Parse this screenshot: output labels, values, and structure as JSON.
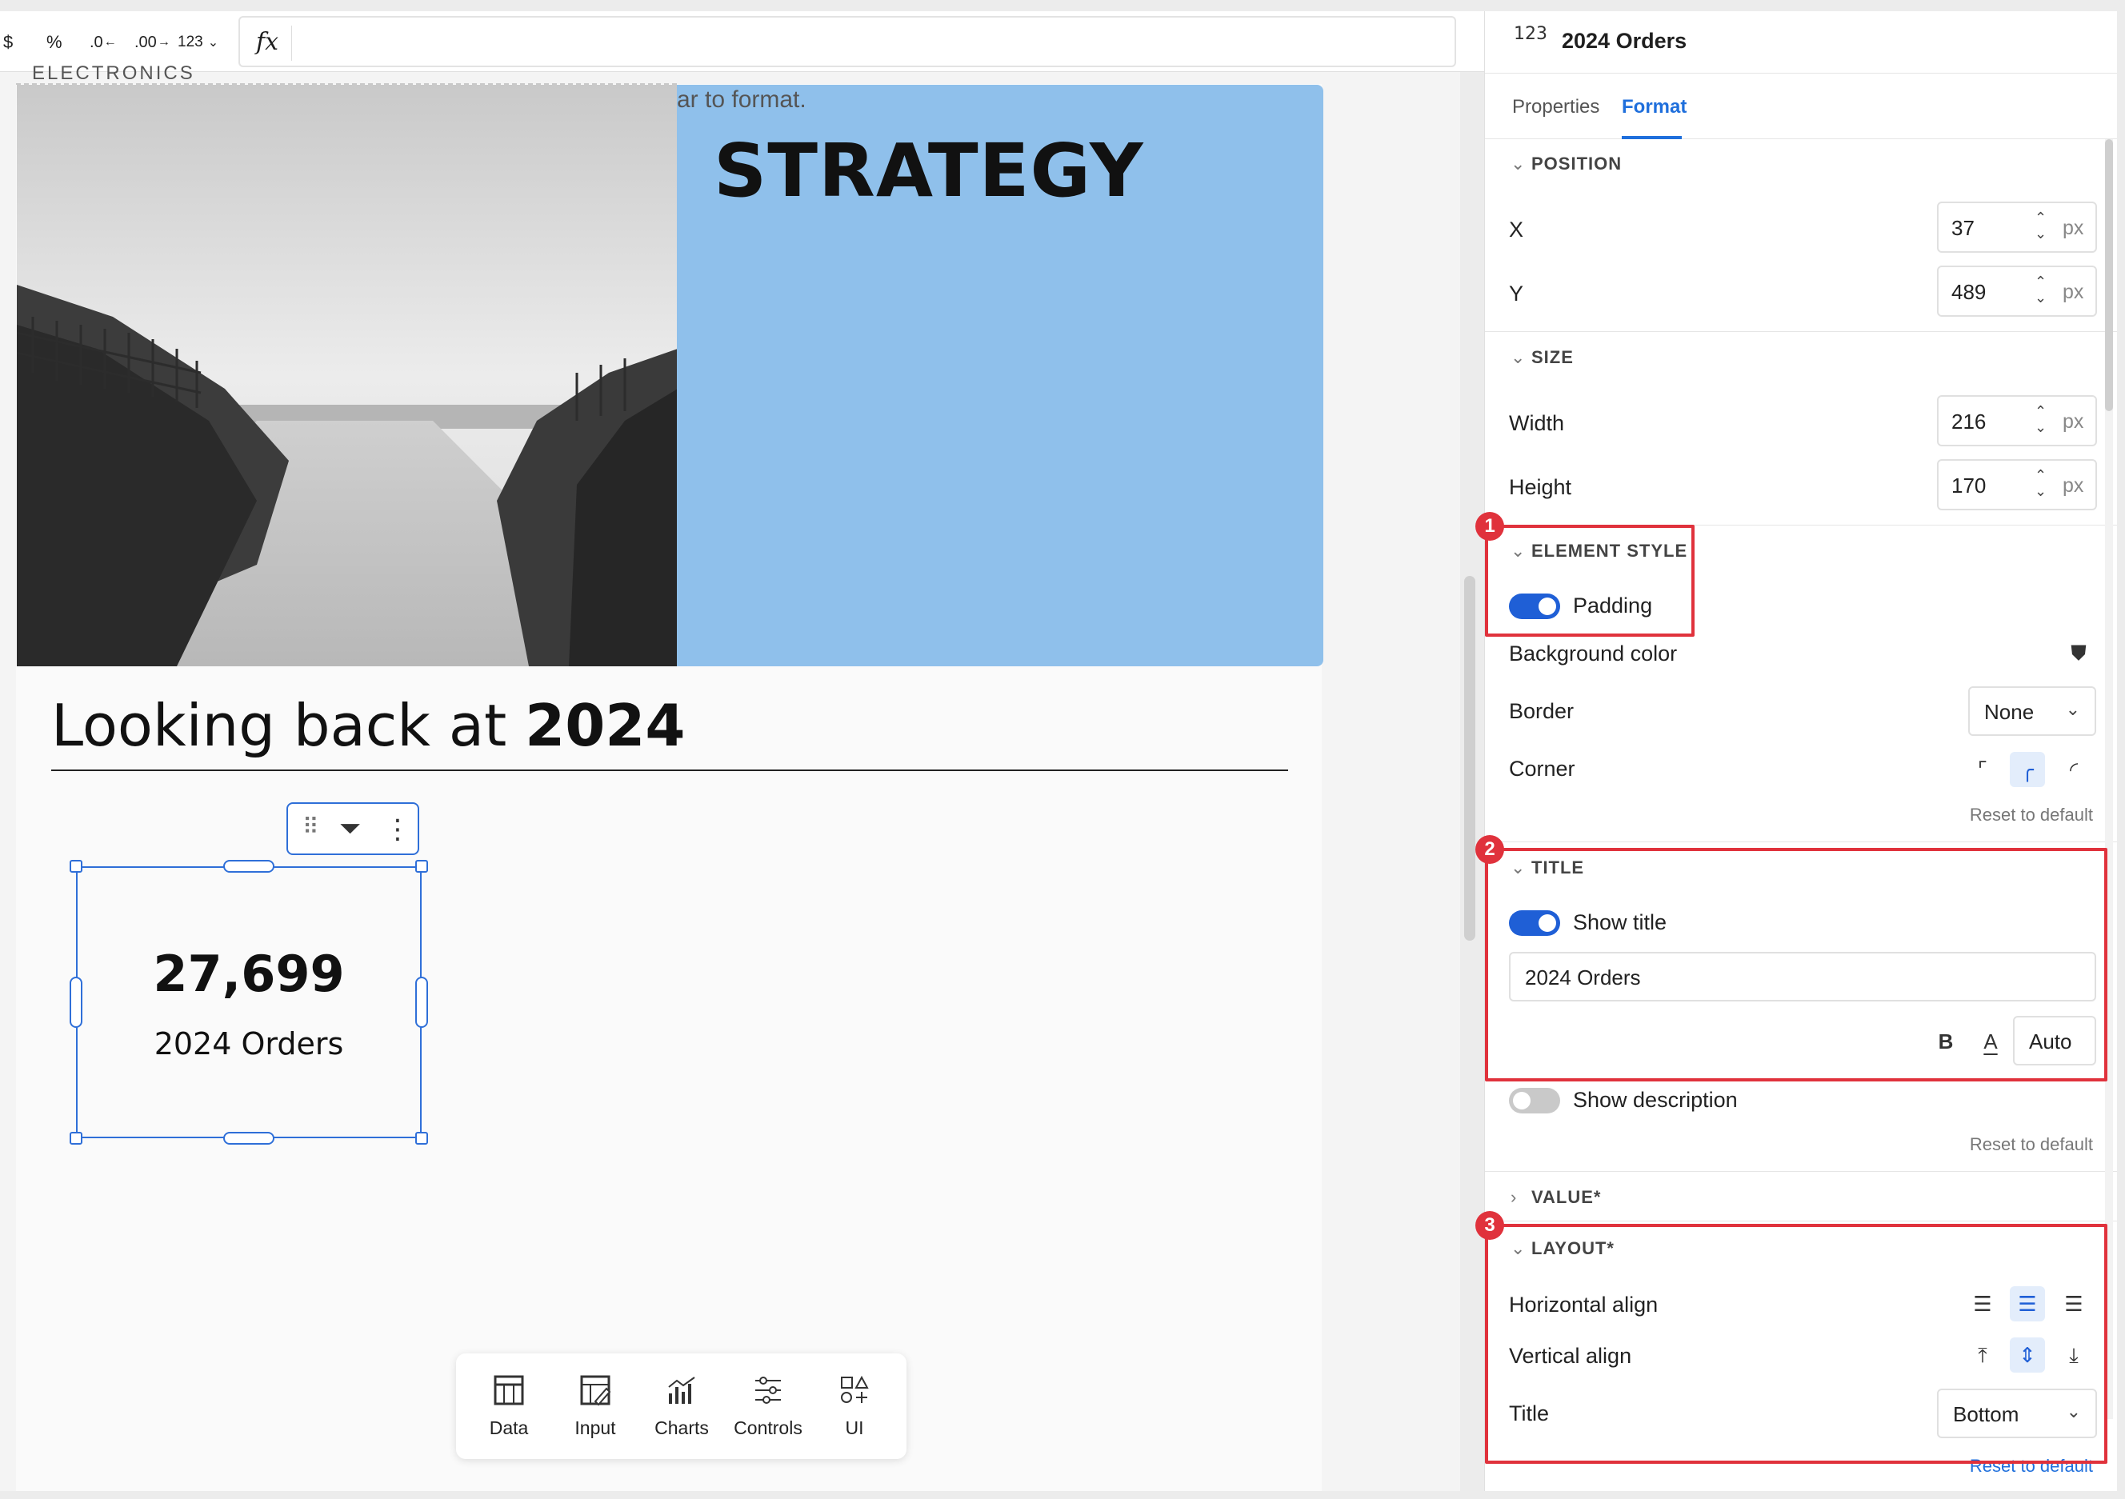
{
  "toolbar": {
    "currency": "$",
    "percent": "%",
    "decrease_decimals": ".0",
    "increase_decimals": ".00",
    "number_format": "123",
    "formula_icon": "fx"
  },
  "canvas": {
    "section_label": "ELECTRONICS",
    "hint": "ar to format.",
    "hero_title": "STRATEGY",
    "heading_regular": "Looking back at ",
    "heading_bold": "2024",
    "kpi_value": "27,699",
    "kpi_title": "2024 Orders"
  },
  "dock": {
    "items": [
      {
        "label": "Data",
        "icon": "table-icon"
      },
      {
        "label": "Input",
        "icon": "input-icon"
      },
      {
        "label": "Charts",
        "icon": "charts-icon"
      },
      {
        "label": "Controls",
        "icon": "controls-icon"
      },
      {
        "label": "UI",
        "icon": "ui-elements-icon"
      }
    ]
  },
  "panel": {
    "element_icon": "123",
    "element_name": "2024 Orders",
    "tabs": {
      "properties": "Properties",
      "format": "Format"
    },
    "position": {
      "header": "POSITION",
      "x_label": "X",
      "x_value": "37",
      "y_label": "Y",
      "y_value": "489",
      "unit": "px"
    },
    "size": {
      "header": "SIZE",
      "width_label": "Width",
      "width_value": "216",
      "height_label": "Height",
      "height_value": "170",
      "unit": "px"
    },
    "element_style": {
      "header": "ELEMENT STYLE",
      "padding_label": "Padding",
      "bg_label": "Background color",
      "border_label": "Border",
      "border_value": "None",
      "corner_label": "Corner",
      "reset": "Reset to default"
    },
    "title": {
      "header": "TITLE",
      "show_title_label": "Show title",
      "title_value": "2024 Orders",
      "bold": "B",
      "color": "A",
      "size": "Auto",
      "show_description_label": "Show description",
      "reset": "Reset to default"
    },
    "value": {
      "header": "VALUE*"
    },
    "layout": {
      "header": "LAYOUT*",
      "h_align_label": "Horizontal align",
      "v_align_label": "Vertical align",
      "title_label": "Title",
      "title_value": "Bottom",
      "reset": "Reset to default"
    },
    "callouts": [
      "1",
      "2",
      "3"
    ]
  },
  "colors": {
    "accent": "#1f6fdc",
    "callout": "#e0323c",
    "hero_blue": "#8fc0eb",
    "selection": "#2f6fd8"
  }
}
